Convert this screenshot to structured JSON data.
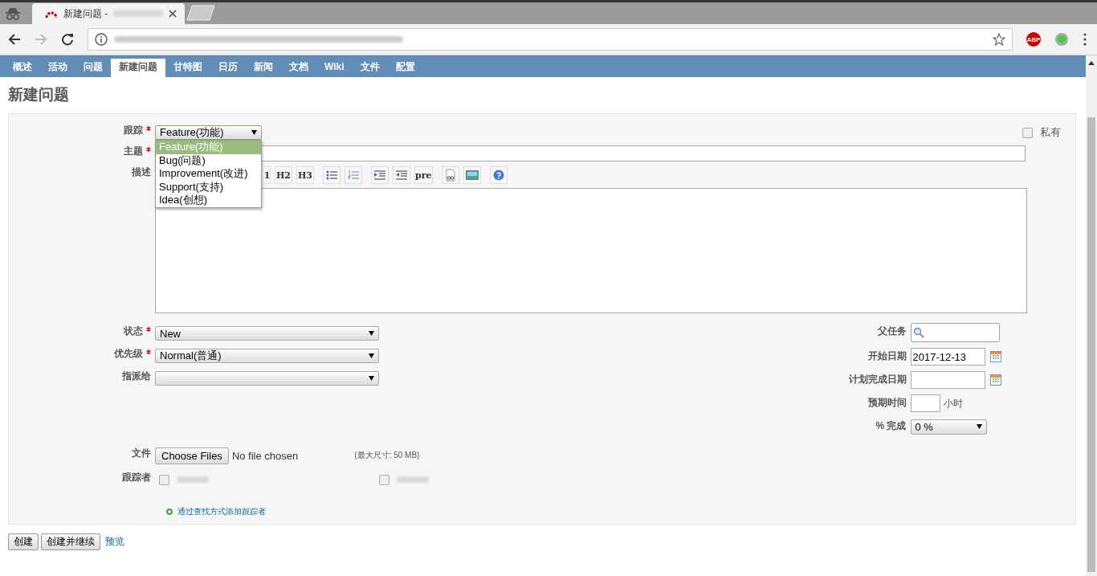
{
  "browser": {
    "tab_title": "新建问题 -",
    "abp_badge": "ABP"
  },
  "nav": [
    {
      "label": "概述",
      "selected": false
    },
    {
      "label": "活动",
      "selected": false
    },
    {
      "label": "问题",
      "selected": false
    },
    {
      "label": "新建问题",
      "selected": true
    },
    {
      "label": "甘特图",
      "selected": false
    },
    {
      "label": "日历",
      "selected": false
    },
    {
      "label": "新闻",
      "selected": false
    },
    {
      "label": "文档",
      "selected": false
    },
    {
      "label": "Wiki",
      "selected": false
    },
    {
      "label": "文件",
      "selected": false
    },
    {
      "label": "配置",
      "selected": false
    }
  ],
  "page_title": "新建问题",
  "form": {
    "tracker": {
      "label": "跟踪",
      "required": true,
      "value": "Feature(功能)",
      "options": [
        {
          "label": "Feature(功能)",
          "selected": true
        },
        {
          "label": "Bug(问题)",
          "selected": false
        },
        {
          "label": "Improvement(改进)",
          "selected": false
        },
        {
          "label": "Support(支持)",
          "selected": false
        },
        {
          "label": "Idea(创想)",
          "selected": false
        }
      ]
    },
    "private": {
      "label": "私有",
      "checked": false
    },
    "subject": {
      "label": "主题",
      "required": true
    },
    "description": {
      "label": "描述",
      "toolbar": [
        {
          "kind": "text",
          "label": "1"
        },
        {
          "kind": "text",
          "label": "H2"
        },
        {
          "kind": "text",
          "label": "H3"
        },
        {
          "kind": "ul"
        },
        {
          "kind": "ol"
        },
        {
          "kind": "indent"
        },
        {
          "kind": "outdent"
        },
        {
          "kind": "text",
          "label": "pre"
        },
        {
          "kind": "link"
        },
        {
          "kind": "image"
        },
        {
          "kind": "help"
        }
      ]
    },
    "left_fields": [
      {
        "label": "状态",
        "required": true,
        "value": "New"
      },
      {
        "label": "优先级",
        "required": true,
        "value": "Normal(普通)"
      },
      {
        "label": "指派给",
        "required": false
      }
    ],
    "right_fields": [
      {
        "kind": "search",
        "label": "父任务"
      },
      {
        "kind": "date",
        "label": "开始日期",
        "value": "2017-12-13"
      },
      {
        "kind": "date",
        "label": "计划完成日期"
      },
      {
        "kind": "hours",
        "label": "预期时间",
        "unit": "小时"
      },
      {
        "kind": "select",
        "label": "% 完成",
        "value": "0 %"
      }
    ],
    "files": {
      "label": "文件",
      "button": "Choose Files",
      "status": "No file chosen",
      "max_size": "(最大尺寸: 50 MB)"
    },
    "watchers": {
      "label": "跟踪者",
      "items": [
        {
          "checked": false
        },
        {
          "checked": false
        }
      ],
      "add_link": "通过查找方式添加跟踪者"
    }
  },
  "actions": {
    "buttons": [
      "创建",
      "创建并继续"
    ],
    "preview": "预览"
  }
}
